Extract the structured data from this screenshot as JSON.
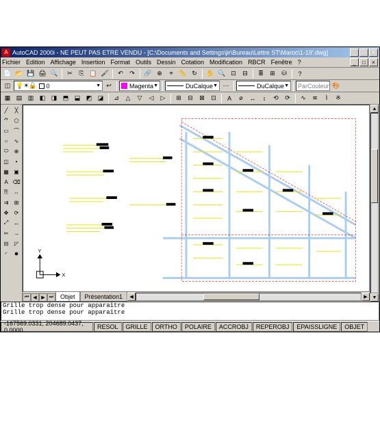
{
  "titlebar": {
    "app_icon": "A",
    "title": "AutoCAD 2000i - NE PEUT PAS ETRE VENDU - [C:\\Documents and Settings\\jir\\Bureau\\Lettre ST\\Maroc\\1-19'.dwg]"
  },
  "winbtns": {
    "min": "_",
    "max": "□",
    "close": "×"
  },
  "menu": {
    "fichier": "Fichier",
    "edition": "Edition",
    "affichage": "Affichage",
    "insertion": "Insertion",
    "format": "Format",
    "outils": "Outils",
    "dessin": "Dessin",
    "cotation": "Cotation",
    "modification": "Modification",
    "rbcr": "RBCR",
    "fenetre": "Fenêtre",
    "help": "?"
  },
  "props": {
    "layer_value": "0",
    "color_value": "Magenta",
    "linetype_value": "DuCalque",
    "lineweight_value": "DuCalque",
    "plotstyle_value": "ParCouleur"
  },
  "tabs": {
    "nav_first": "⏮",
    "nav_prev": "◀",
    "nav_next": "▶",
    "nav_last": "⏭",
    "model": "Objet",
    "layout1": "Présentation1"
  },
  "ucs": {
    "x": "X",
    "y": "Y"
  },
  "command": {
    "line1": "Grille trop dense pour apparaître",
    "line2": "Grille trop dense pour apparaître",
    "prompt": ""
  },
  "status": {
    "coords": "-167569.0331, 204689.0437, 0.0000",
    "resol": "RESOL",
    "grille": "GRILLE",
    "ortho": "ORTHO",
    "polaire": "POLAIRE",
    "accrobj": "ACCROBJ",
    "reperobj": "REPEROBJ",
    "epaissligne": "EPAISSLIGNE",
    "objet": "OBJET"
  }
}
